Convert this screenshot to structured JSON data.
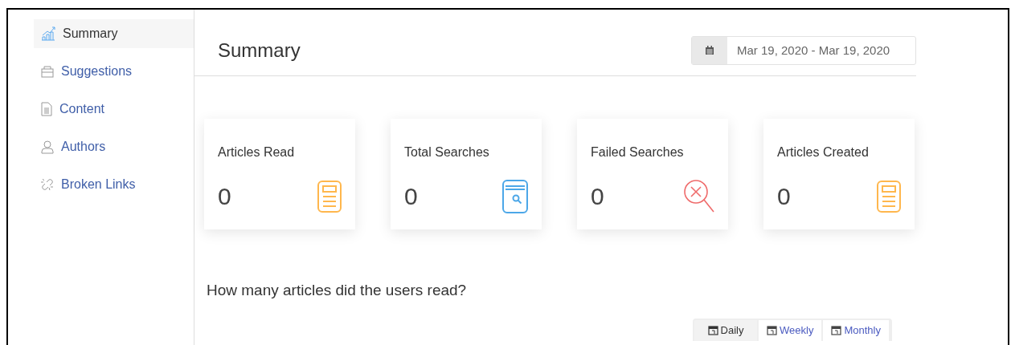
{
  "sidebar": {
    "items": [
      {
        "label": "Summary",
        "selected": true
      },
      {
        "label": "Suggestions",
        "selected": false
      },
      {
        "label": "Content",
        "selected": false
      },
      {
        "label": "Authors",
        "selected": false
      },
      {
        "label": "Broken Links",
        "selected": false
      }
    ]
  },
  "header": {
    "title": "Summary",
    "date_range": "Mar 19, 2020 - Mar 19, 2020"
  },
  "cards": [
    {
      "label": "Articles Read",
      "value": "0",
      "color": "#ffb74d"
    },
    {
      "label": "Total Searches",
      "value": "0",
      "color": "#4ca7e8"
    },
    {
      "label": "Failed Searches",
      "value": "0",
      "color": "#ef6b6b"
    },
    {
      "label": "Articles Created",
      "value": "0",
      "color": "#ffb74d"
    }
  ],
  "question": "How many articles did the users read?",
  "period_tabs": [
    {
      "label": "Daily",
      "selected": true
    },
    {
      "label": "Weekly",
      "selected": false
    },
    {
      "label": "Monthly",
      "selected": false
    }
  ]
}
